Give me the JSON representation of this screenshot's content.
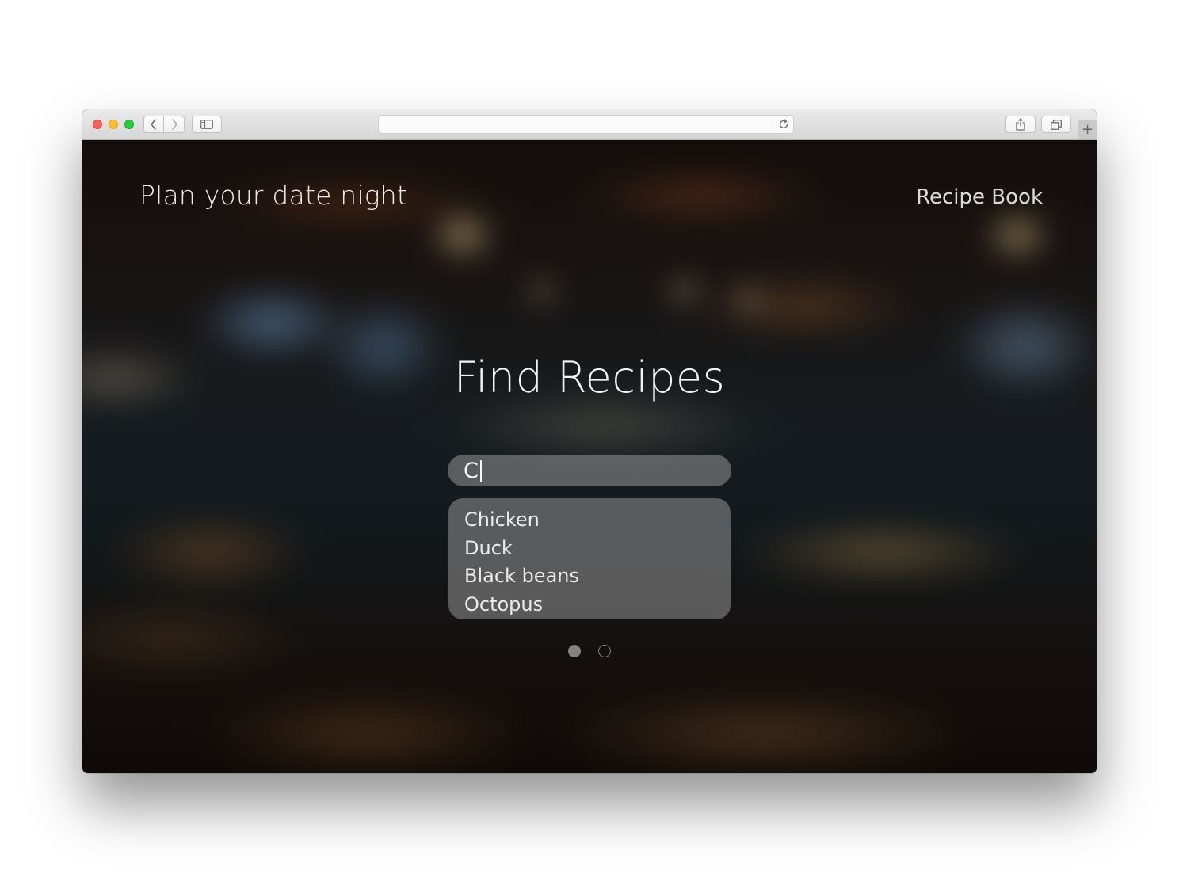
{
  "browser": {
    "controls": {
      "close": "close-window",
      "minimize": "minimize-window",
      "zoom": "zoom-window"
    },
    "icons": {
      "back": "chevron-left-icon",
      "forward": "chevron-right-icon",
      "sidebar": "sidebar-icon",
      "reload": "reload-icon",
      "share": "share-icon",
      "tabs": "tabs-icon",
      "new_tab": "+"
    },
    "address": ""
  },
  "header": {
    "title": "Plan your date night",
    "nav_link": "Recipe Book"
  },
  "main": {
    "heading": "Find Recipes",
    "search": {
      "value": "C"
    },
    "suggestions": [
      "Chicken",
      "Duck",
      "Black beans",
      "Octopus"
    ],
    "pagination": {
      "total": 2,
      "active": 1
    }
  },
  "colors": {
    "traffic_red": "#fc5f57",
    "traffic_yellow": "#fdbc2e",
    "traffic_green": "#28c840"
  }
}
